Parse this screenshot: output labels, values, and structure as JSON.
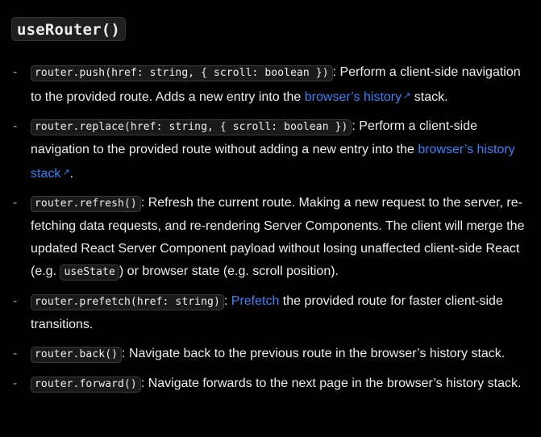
{
  "heading": "useRouter()",
  "link_color": "#3b82f6",
  "external_icon": "↗",
  "items": [
    {
      "code": "router.push(href: string, { scroll: boolean })",
      "text_before_link": ": Perform a client-side navigation to the provided route. Adds a new entry into the ",
      "link": "browser’s history",
      "text_after_link": " stack."
    },
    {
      "code": "router.replace(href: string, { scroll: boolean })",
      "text_before_link": ": Perform a client-side navigation to the provided route without adding a new entry into the ",
      "link": "browser’s history stack",
      "text_after_link": "."
    },
    {
      "code": "router.refresh()",
      "text_1": ": Refresh the current route. Making a new request to the server, re-fetching data requests, and re-rendering Server Components. The client will merge the updated React Server Component payload without losing unaffected client-side React (e.g. ",
      "inline_code": "useState",
      "text_2": ") or browser state (e.g. scroll position)."
    },
    {
      "code": "router.prefetch(href: string)",
      "text_before_link": ": ",
      "link": "Prefetch",
      "text_after_link": " the provided route for faster client-side transitions."
    },
    {
      "code": "router.back()",
      "text": ": Navigate back to the previous route in the browser’s history stack."
    },
    {
      "code": "router.forward()",
      "text": ": Navigate forwards to the next page in the browser’s history stack."
    }
  ]
}
